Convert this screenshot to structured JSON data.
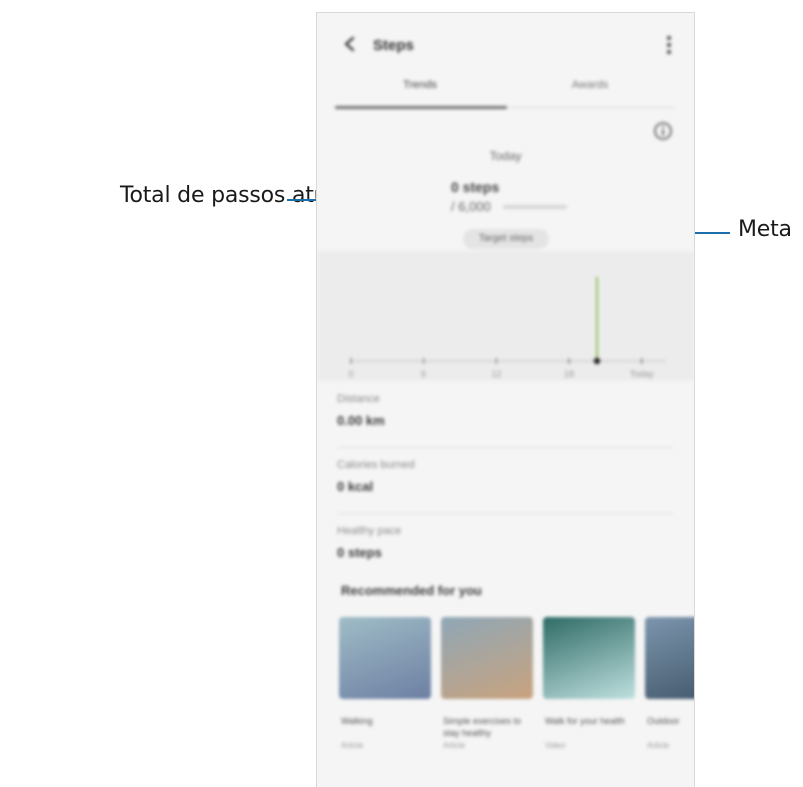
{
  "callouts": {
    "left_label": "Total de passos atuais",
    "right_label": "Meta"
  },
  "app": {
    "title": "Steps",
    "tabs": [
      {
        "label": "Trends",
        "active": true
      },
      {
        "label": "Awards",
        "active": false
      }
    ]
  },
  "summary": {
    "date_label": "Today",
    "current_steps": "0 steps",
    "goal_steps": "/ 6,000",
    "goal_button": "Target steps"
  },
  "chart_data": {
    "type": "line",
    "x_tick_labels": [
      "0",
      "6",
      "12",
      "18",
      "Today"
    ],
    "marker": "current-day"
  },
  "stats": [
    {
      "label": "Distance",
      "value": "0.00 km"
    },
    {
      "label": "Calories burned",
      "value": "0 kcal"
    },
    {
      "label": "Healthy pace",
      "value": "0 steps"
    }
  ],
  "recommended": {
    "title": "Recommended for you",
    "cards": [
      {
        "title": "Walking",
        "subtitle": "Article",
        "colors": [
          "#9fbcc6",
          "#6d7fa3"
        ]
      },
      {
        "title": "Simple exercises to stay healthy",
        "subtitle": "Article",
        "colors": [
          "#8fa7b6",
          "#c9a37e"
        ]
      },
      {
        "title": "Walk for your health",
        "subtitle": "Video",
        "colors": [
          "#2f6b66",
          "#bfe0df"
        ]
      },
      {
        "title": "Outdoor",
        "subtitle": "Article",
        "colors": [
          "#7c95ad",
          "#3f5567"
        ]
      }
    ]
  },
  "colors": {
    "callout_line": "#1b6fa8",
    "chart_marker": "#7fb33a"
  }
}
